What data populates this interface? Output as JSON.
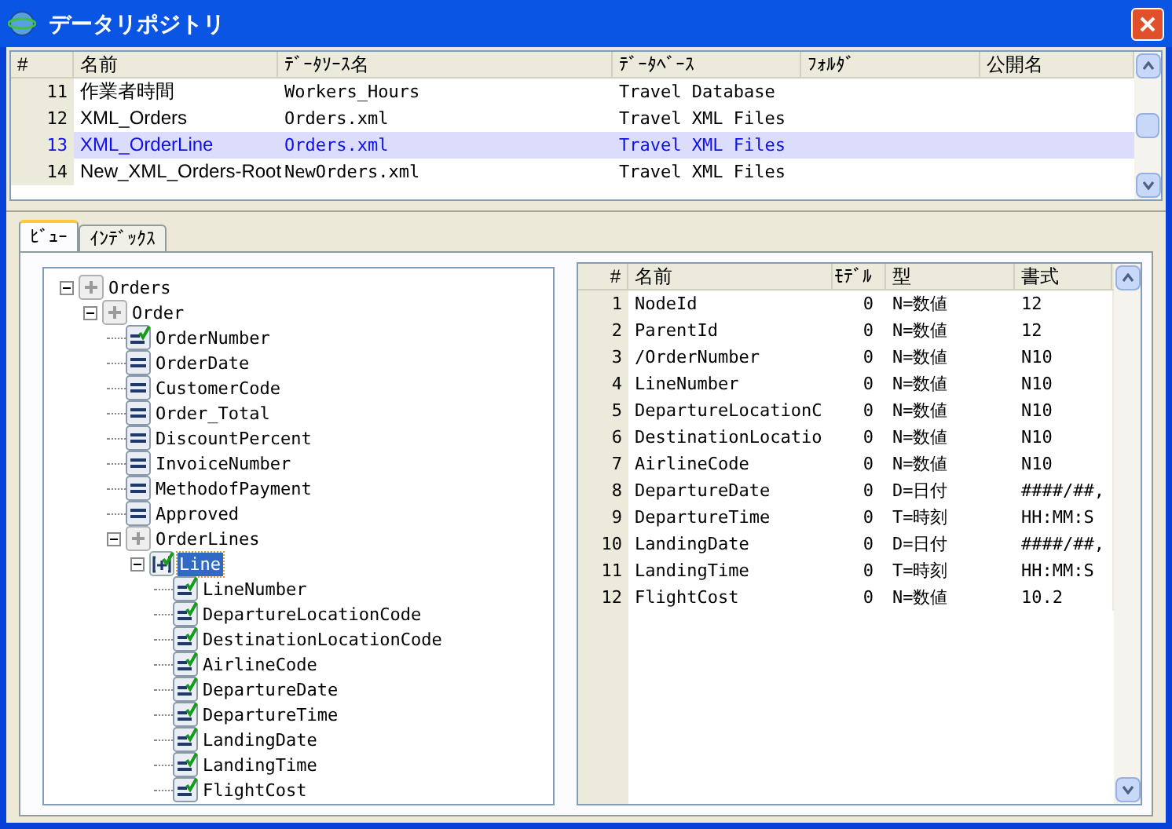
{
  "window": {
    "title": "データリポジトリ"
  },
  "sources_table": {
    "columns": [
      "#",
      "名前",
      "ﾃﾞｰﾀｿｰｽ名",
      "ﾃﾞｰﾀﾍﾞｰｽ",
      "ﾌｫﾙﾀﾞ",
      "公開名"
    ],
    "rows": [
      {
        "cells": [
          "11",
          "作業者時間",
          "Workers_Hours",
          "Travel Database",
          "",
          ""
        ],
        "selected": false
      },
      {
        "cells": [
          "12",
          "XML_Orders",
          "Orders.xml",
          "Travel XML Files",
          "",
          ""
        ],
        "selected": false
      },
      {
        "cells": [
          "13",
          "XML_OrderLine",
          "Orders.xml",
          "Travel XML Files",
          "",
          ""
        ],
        "selected": true
      },
      {
        "cells": [
          "14",
          "New_XML_Orders-Root",
          "NewOrders.xml",
          "Travel XML Files",
          "",
          ""
        ],
        "selected": false
      }
    ]
  },
  "tabs": [
    {
      "label": "ﾋﾞｭｰ",
      "selected": true
    },
    {
      "label": "ｲﾝﾃﾞｯｸｽ",
      "selected": false
    }
  ],
  "tree": [
    {
      "label": "Orders",
      "kind": "group",
      "checked": false,
      "selected": false,
      "expanded": true,
      "children": [
        {
          "label": "Order",
          "kind": "group",
          "checked": false,
          "selected": false,
          "expanded": true,
          "children": [
            {
              "label": "OrderNumber",
              "kind": "field",
              "checked": true,
              "selected": false
            },
            {
              "label": "OrderDate",
              "kind": "field",
              "checked": false,
              "selected": false
            },
            {
              "label": "CustomerCode",
              "kind": "field",
              "checked": false,
              "selected": false
            },
            {
              "label": "Order_Total",
              "kind": "field",
              "checked": false,
              "selected": false
            },
            {
              "label": "DiscountPercent",
              "kind": "field",
              "checked": false,
              "selected": false
            },
            {
              "label": "InvoiceNumber",
              "kind": "field",
              "checked": false,
              "selected": false
            },
            {
              "label": "MethodofPayment",
              "kind": "field",
              "checked": false,
              "selected": false
            },
            {
              "label": "Approved",
              "kind": "field",
              "checked": false,
              "selected": false
            },
            {
              "label": "OrderLines",
              "kind": "group",
              "checked": false,
              "selected": false,
              "expanded": true,
              "children": [
                {
                  "label": "Line",
                  "kind": "record",
                  "checked": true,
                  "selected": true,
                  "expanded": true,
                  "children": [
                    {
                      "label": "LineNumber",
                      "kind": "field",
                      "checked": true,
                      "selected": false
                    },
                    {
                      "label": "DepartureLocationCode",
                      "kind": "field",
                      "checked": true,
                      "selected": false
                    },
                    {
                      "label": "DestinationLocationCode",
                      "kind": "field",
                      "checked": true,
                      "selected": false
                    },
                    {
                      "label": "AirlineCode",
                      "kind": "field",
                      "checked": true,
                      "selected": false
                    },
                    {
                      "label": "DepartureDate",
                      "kind": "field",
                      "checked": true,
                      "selected": false
                    },
                    {
                      "label": "DepartureTime",
                      "kind": "field",
                      "checked": true,
                      "selected": false
                    },
                    {
                      "label": "LandingDate",
                      "kind": "field",
                      "checked": true,
                      "selected": false
                    },
                    {
                      "label": "LandingTime",
                      "kind": "field",
                      "checked": true,
                      "selected": false
                    },
                    {
                      "label": "FlightCost",
                      "kind": "field",
                      "checked": true,
                      "selected": false
                    }
                  ]
                }
              ]
            }
          ]
        }
      ]
    }
  ],
  "fields_table": {
    "columns": [
      "#",
      "名前",
      "ﾓﾃﾞﾙ",
      "型",
      "書式"
    ],
    "rows": [
      [
        "1",
        "NodeId",
        "0",
        "N=数値",
        "12"
      ],
      [
        "2",
        "ParentId",
        "0",
        "N=数値",
        "12"
      ],
      [
        "3",
        "/OrderNumber",
        "0",
        "N=数値",
        "N10"
      ],
      [
        "4",
        "LineNumber",
        "0",
        "N=数値",
        "N10"
      ],
      [
        "5",
        "DepartureLocationC",
        "0",
        "N=数値",
        "N10"
      ],
      [
        "6",
        "DestinationLocatio",
        "0",
        "N=数値",
        "N10"
      ],
      [
        "7",
        "AirlineCode",
        "0",
        "N=数値",
        "N10"
      ],
      [
        "8",
        "DepartureDate",
        "0",
        "D=日付",
        "####/##,"
      ],
      [
        "9",
        "DepartureTime",
        "0",
        "T=時刻",
        "HH:MM:S"
      ],
      [
        "10",
        "LandingDate",
        "0",
        "D=日付",
        "####/##,"
      ],
      [
        "11",
        "LandingTime",
        "0",
        "T=時刻",
        "HH:MM:S"
      ],
      [
        "12",
        "FlightCost",
        "0",
        "N=数値",
        "10.2"
      ]
    ]
  }
}
